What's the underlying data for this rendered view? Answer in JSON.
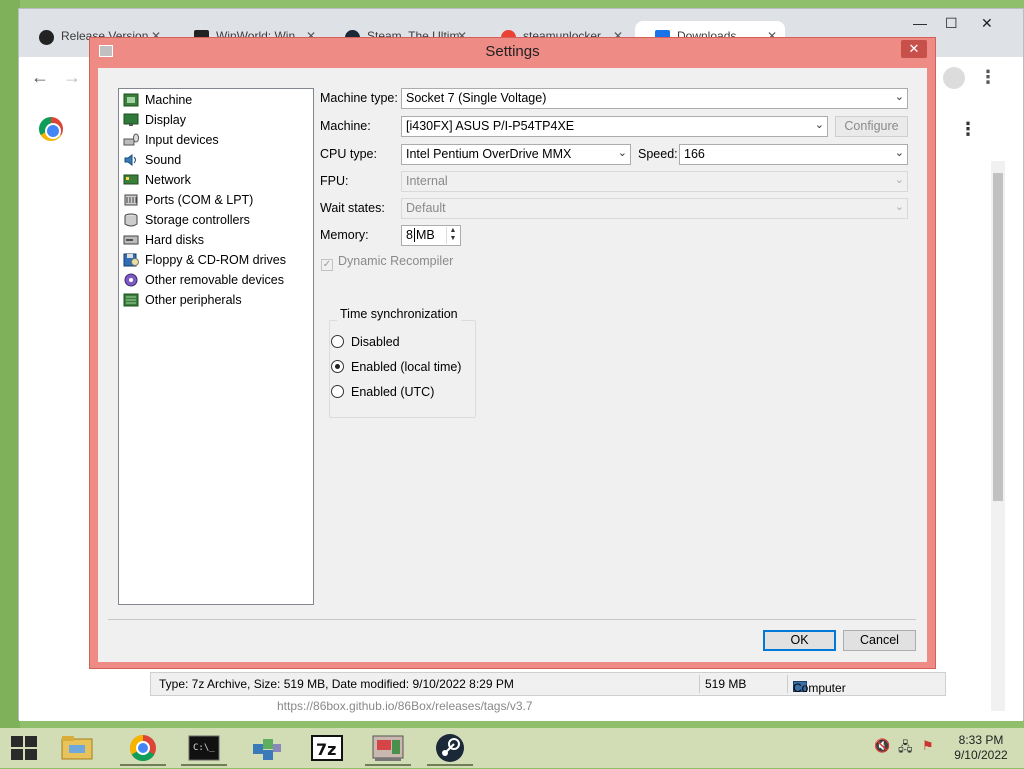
{
  "browser": {
    "tabs": [
      {
        "label": "Release Version",
        "icon": "github-icon"
      },
      {
        "label": "WinWorld: Win",
        "icon": "winworld-icon"
      },
      {
        "label": "Steam, The Ultim",
        "icon": "steam-icon"
      },
      {
        "label": "steamunlocker",
        "icon": "google-icon"
      },
      {
        "label": "Downloads",
        "icon": "download-icon"
      }
    ],
    "status_bar": {
      "info": "Type: 7z Archive, Size: 519 MB, Date modified: 9/10/2022 8:29 PM",
      "size": "519 MB",
      "location": "Computer"
    },
    "page_url_fragment": "https://86box.github.io/86Box/releases/tags/v3.7"
  },
  "dialog": {
    "title": "Settings",
    "categories": [
      {
        "label": "Machine",
        "icon": "machine-icon"
      },
      {
        "label": "Display",
        "icon": "display-icon"
      },
      {
        "label": "Input devices",
        "icon": "input-devices-icon"
      },
      {
        "label": "Sound",
        "icon": "sound-icon"
      },
      {
        "label": "Network",
        "icon": "network-icon"
      },
      {
        "label": "Ports (COM & LPT)",
        "icon": "ports-icon"
      },
      {
        "label": "Storage controllers",
        "icon": "storage-controllers-icon"
      },
      {
        "label": "Hard disks",
        "icon": "hard-disks-icon"
      },
      {
        "label": "Floppy & CD-ROM drives",
        "icon": "floppy-cdrom-icon"
      },
      {
        "label": "Other removable devices",
        "icon": "removable-devices-icon"
      },
      {
        "label": "Other peripherals",
        "icon": "peripherals-icon"
      }
    ],
    "fields": {
      "machine_type_label": "Machine type:",
      "machine_type_value": "Socket 7 (Single Voltage)",
      "machine_label": "Machine:",
      "machine_value": "[i430FX] ASUS P/I-P54TP4XE",
      "configure_label": "Configure",
      "cpu_type_label": "CPU type:",
      "cpu_type_value": "Intel Pentium OverDrive MMX",
      "speed_label": "Speed:",
      "speed_value": "166",
      "fpu_label": "FPU:",
      "fpu_value": "Internal",
      "wait_states_label": "Wait states:",
      "wait_states_value": "Default",
      "memory_label": "Memory:",
      "memory_value": "8",
      "memory_unit": "MB",
      "dynamic_recompiler_label": "Dynamic Recompiler",
      "dynamic_recompiler_checked": true
    },
    "time_sync": {
      "title": "Time synchronization",
      "options": [
        "Disabled",
        "Enabled (local time)",
        "Enabled (UTC)"
      ],
      "selected": "Enabled (local time)"
    },
    "buttons": {
      "ok": "OK",
      "cancel": "Cancel"
    }
  },
  "taskbar": {
    "apps": [
      "file-explorer-icon",
      "chrome-icon",
      "command-prompt-icon",
      "registry-editor-icon",
      "7zip-icon",
      "86box-icon",
      "steam-icon"
    ],
    "clock": {
      "time": "8:33 PM",
      "date": "9/10/2022"
    }
  },
  "colors": {
    "dialog_frame": "#ee8b84",
    "dialog_close": "#c7504a",
    "taskbar": "#d2ddb6",
    "desktop": "#8fbf6a"
  }
}
